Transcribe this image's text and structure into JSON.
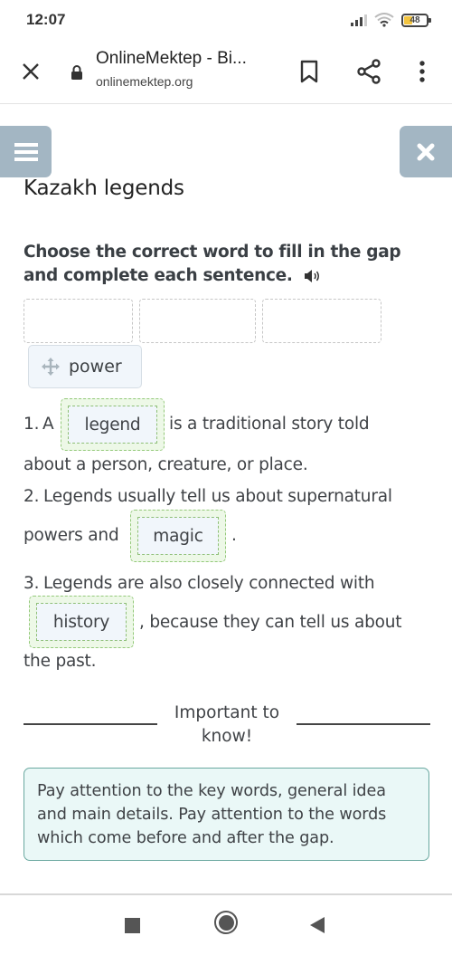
{
  "status_bar": {
    "time": "12:07",
    "battery_level": "48"
  },
  "browser": {
    "page_title": "OnlineMektep - Bi...",
    "url": "onlinemektep.org"
  },
  "lesson": {
    "title": "Kazakh legends",
    "instruction": "Choose the correct word to fill in the gap and complete each sentence.",
    "drop_zones_count": 3,
    "word_bank": [
      {
        "label": "power"
      }
    ],
    "sentences": [
      {
        "number": "1.",
        "before": "A",
        "answer": "legend",
        "after": "is a traditional story told",
        "continuation": "about a person, creature, or place."
      },
      {
        "number": "2.",
        "before": "Legends usually tell us about supernatural",
        "before_line2": "powers and",
        "answer": "magic",
        "after": "."
      },
      {
        "number": "3.",
        "before": "Legends are also closely connected with",
        "answer": "history",
        "after": ", because they can tell us about",
        "continuation": "the past."
      }
    ],
    "important_heading": "Important to know!",
    "important_line1": "Important to",
    "important_line2": "know!",
    "tip": "Pay attention to the key words, general idea and main details. Pay attention to the words which come before and after the gap."
  },
  "colors": {
    "header_button_bg": "#a3b6c3",
    "slot_border_green": "#94c97a",
    "slot_bg_green": "#edf8e7",
    "chip_bg": "#f1f6fb",
    "tip_bg": "#eaf8f7",
    "tip_border": "#6aa8a0"
  },
  "icons": {
    "close": "close-icon",
    "lock": "lock-icon",
    "bookmark": "bookmark-icon",
    "share": "share-icon",
    "more": "more-vert-icon",
    "menu": "hamburger-icon",
    "exit": "x-icon",
    "audio": "speaker-icon",
    "drag": "move-icon"
  }
}
